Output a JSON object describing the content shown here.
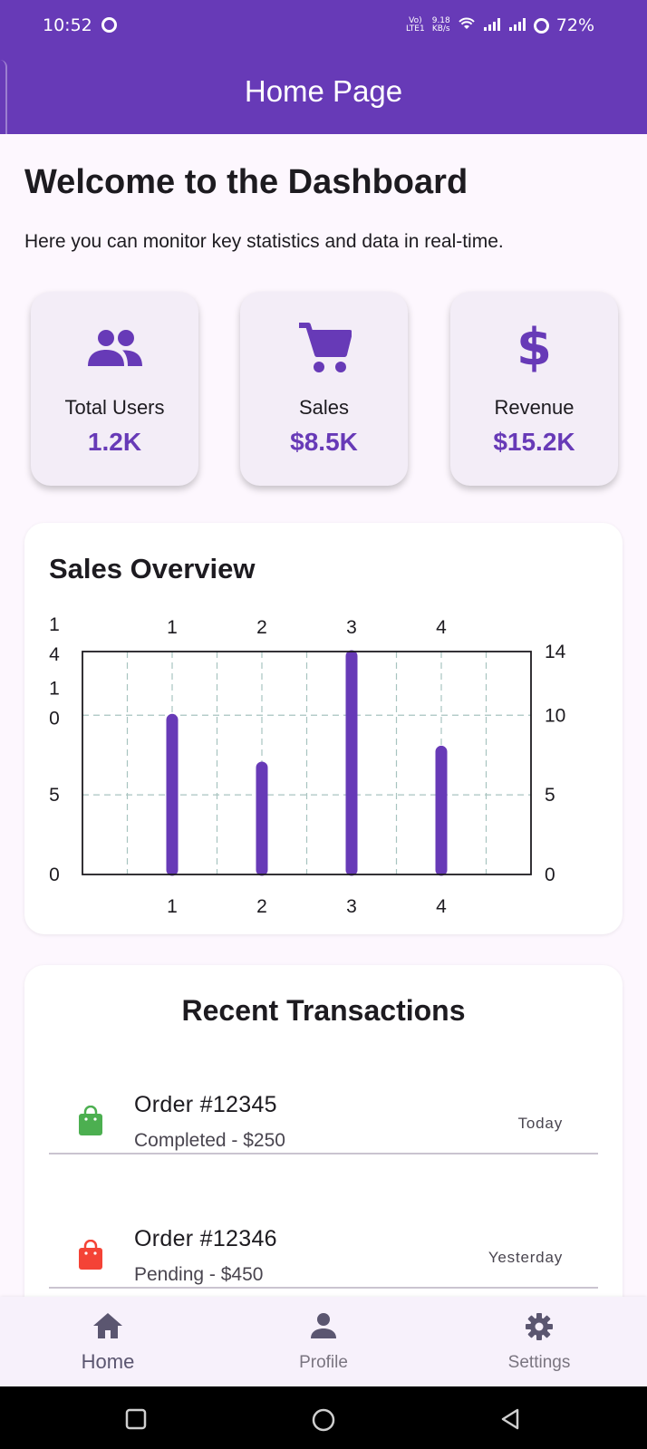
{
  "status_bar": {
    "time": "10:52",
    "net_top": "Vo)",
    "net_bottom": "LTE1",
    "speed_value": "9.18",
    "speed_unit": "KB/s",
    "battery": "72%"
  },
  "app_bar": {
    "title": "Home Page"
  },
  "welcome": {
    "title": "Welcome to the Dashboard",
    "subtitle": "Here you can monitor key statistics and data in real-time."
  },
  "stats": [
    {
      "icon": "group-icon",
      "label": "Total Users",
      "value": "1.2K"
    },
    {
      "icon": "shopping-cart-icon",
      "label": "Sales",
      "value": "$8.5K"
    },
    {
      "icon": "dollar-icon",
      "label": "Revenue",
      "value": "$15.2K"
    }
  ],
  "sales_overview": {
    "title": "Sales Overview"
  },
  "chart_data": {
    "type": "bar",
    "title": "Sales Overview",
    "x": [
      1,
      2,
      3,
      4
    ],
    "values": [
      10,
      7,
      14,
      8
    ],
    "x_ticks_top": [
      "1",
      "2",
      "3",
      "4"
    ],
    "x_ticks_bottom": [
      "1",
      "2",
      "3",
      "4"
    ],
    "y_ticks_left": [
      "1\n4",
      "1\n0",
      "5",
      "0"
    ],
    "y_ticks_right": [
      "14",
      "10",
      "5",
      "0"
    ],
    "ylim": [
      0,
      14
    ],
    "xlim": [
      0,
      5
    ],
    "grid": true,
    "bar_color": "#673ab7"
  },
  "transactions": {
    "title": "Recent Transactions",
    "items": [
      {
        "order": "Order #12345",
        "status": "Completed - $250",
        "date": "Today",
        "icon": "shopping-bag-icon",
        "color": "#4caf50"
      },
      {
        "order": "Order #12346",
        "status": "Pending - $450",
        "date": "Yesterday",
        "icon": "shopping-bag-icon",
        "color": "#f44336"
      }
    ]
  },
  "bottom_nav": {
    "items": [
      {
        "label": "Home",
        "icon": "home-icon",
        "active": true
      },
      {
        "label": "Profile",
        "icon": "person-icon",
        "active": false
      },
      {
        "label": "Settings",
        "icon": "gear-icon",
        "active": false
      }
    ]
  },
  "colors": {
    "primary": "#673ab7",
    "background": "#fdf7fe",
    "card": "#f3edf7"
  }
}
